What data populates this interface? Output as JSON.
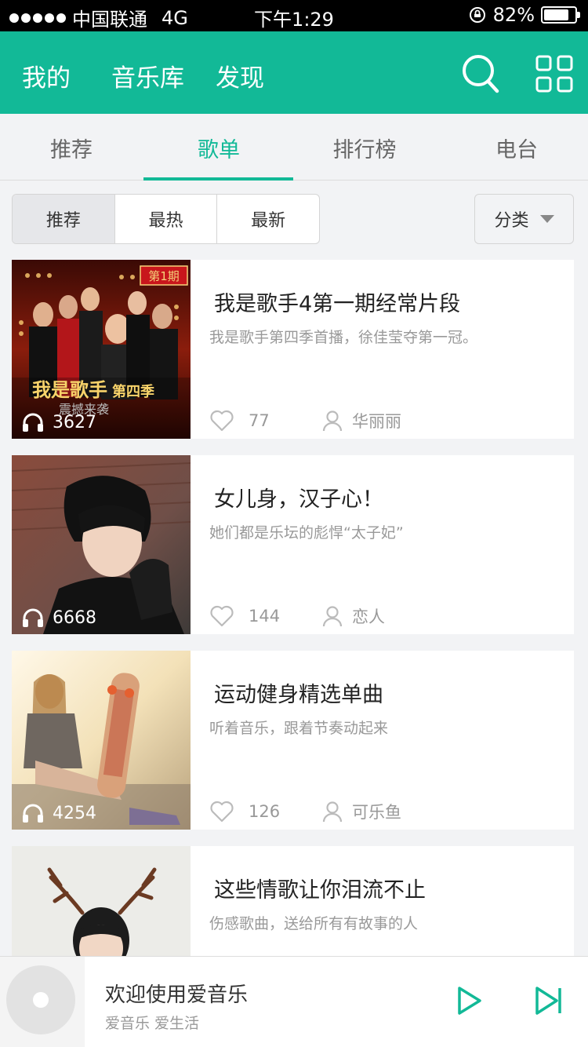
{
  "status_bar": {
    "carrier": "中国联通",
    "network": "4G",
    "time": "下午1:29",
    "battery": "82%",
    "battery_level": 0.82
  },
  "header": {
    "nav": [
      "我的",
      "音乐库",
      "发现"
    ],
    "search_icon": "search-icon",
    "menu_icon": "grid-icon"
  },
  "tabs": {
    "items": [
      "推荐",
      "歌单",
      "排行榜",
      "电台"
    ],
    "active": 1
  },
  "filter": {
    "segments": [
      "推荐",
      "最热",
      "最新"
    ],
    "active": 0,
    "category": "分类"
  },
  "playlists": [
    {
      "title": "我是歌手4第一期经常片段",
      "desc": "我是歌手第四季首播，徐佳莹夺第一冠。",
      "plays": "3627",
      "likes": "77",
      "author": "华丽丽"
    },
    {
      "title": "女儿身，汉子心！",
      "desc": "她们都是乐坛的彪悍“太子妃”",
      "plays": "6668",
      "likes": "144",
      "author": "恋人"
    },
    {
      "title": "运动健身精选单曲",
      "desc": "听着音乐，跟着节奏动起来",
      "plays": "4254",
      "likes": "126",
      "author": "可乐鱼"
    },
    {
      "title": "这些情歌让你泪流不止",
      "desc": "伤感歌曲，送给所有有故事的人"
    }
  ],
  "thumb_text": {
    "badge": "第1期",
    "show_name": "我是歌手",
    "season": "第四季",
    "tagline": "震撼来袭"
  },
  "player": {
    "title": "欢迎使用爱音乐",
    "subtitle": "爱音乐  爱生活"
  },
  "colors": {
    "accent": "#12b997"
  }
}
